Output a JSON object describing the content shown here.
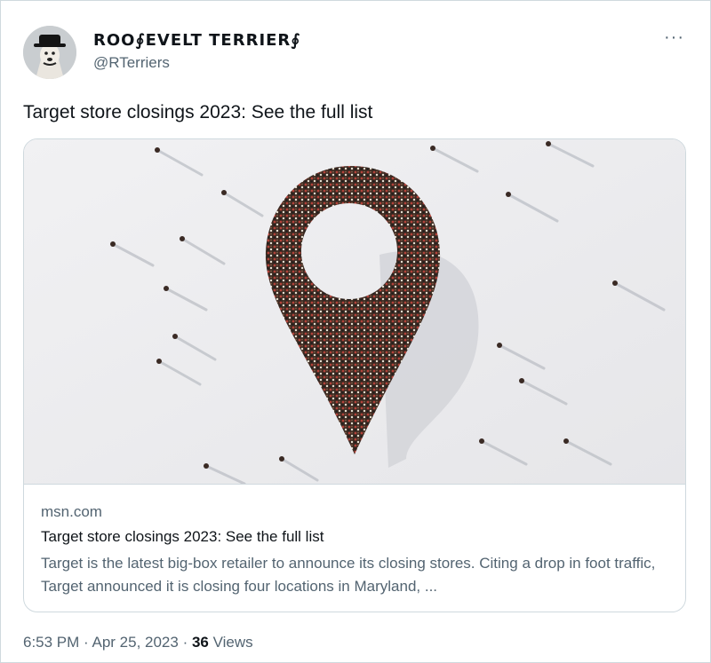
{
  "user": {
    "display_name": "ROO∮EVELT TERRIER∮",
    "handle": "@RTerriers"
  },
  "more_label": "···",
  "tweet": {
    "text": "Target store closings 2023: See the full list"
  },
  "card": {
    "domain": "msn.com",
    "title": "Target store closings 2023: See the full list",
    "description": "Target is the latest big-box retailer to announce its closing stores. Citing a drop in foot traffic, Target announced it is closing four locations in Maryland, ..."
  },
  "meta": {
    "time": "6:53 PM",
    "date": "Apr 25, 2023",
    "separator": " · ",
    "views_count": "36",
    "views_label": "Views"
  }
}
